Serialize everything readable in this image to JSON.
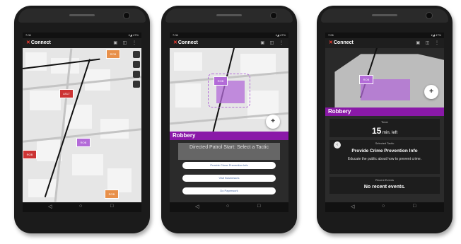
{
  "status": {
    "time": "7:06",
    "right": "▾◢ 47%"
  },
  "app": {
    "name": "Connect",
    "logo_mark": "✕"
  },
  "phone1": {
    "crime_labels": [
      "ASLT",
      "ROB",
      "ROB",
      "ROB",
      "ROB"
    ],
    "map_buttons": [
      "layers-icon",
      "locate-icon",
      "filter-icon",
      "list-icon"
    ]
  },
  "phone2": {
    "crime_label": "ROB",
    "title": "Robbery",
    "prompt": "Directed Patrol Start: Select a Tactic",
    "tactics": [
      "Provide Crime Prevention Info",
      "Visit Businesses",
      "Do Paperwork"
    ]
  },
  "phone3": {
    "crime_label": "ROB",
    "title": "Robbery",
    "timer_caption": "Timer",
    "timer_value": "15",
    "timer_unit": "min. left",
    "tactic_caption": "Selected Tactic",
    "tactic_name": "Provide Crime Prevention Info",
    "tactic_desc": "Educate the public about how to prevent crime.",
    "events_caption": "Recent Events",
    "events_text": "No recent events."
  },
  "nav": {
    "back": "◁",
    "home": "○",
    "recents": "□"
  },
  "colors": {
    "purple": "#8a19a8",
    "crime_red": "#cc3333",
    "crime_orange": "#e8904a"
  }
}
